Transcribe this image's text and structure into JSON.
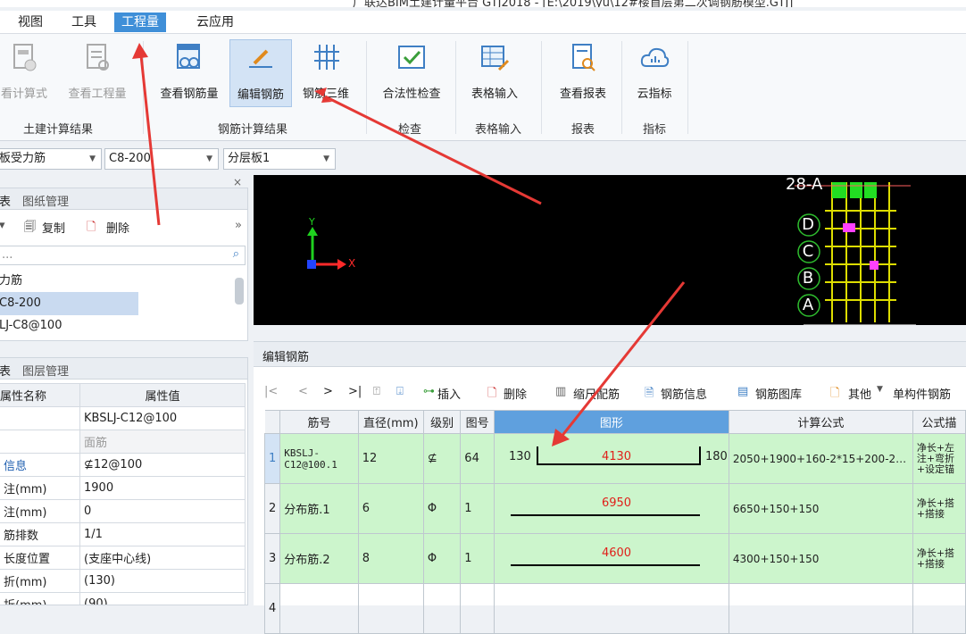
{
  "titlebar": {
    "text": "广联达BIM土建计量平台 GTJ2018 - [E:\\2019\\yu\\12#楼首层第二次调钢筋模型.GTJ]"
  },
  "menu": [
    {
      "label": "视图"
    },
    {
      "label": "工具"
    },
    {
      "label": "工程量",
      "active": true
    },
    {
      "label": "云应用"
    }
  ],
  "ribbon": {
    "buttons": [
      {
        "label": "看计算式",
        "icon": "calc-formula-icon"
      },
      {
        "label": "查看工程量",
        "icon": "view-quantity-icon"
      },
      {
        "label": "查看钢筋量",
        "icon": "view-rebar-quantity-icon"
      },
      {
        "label": "编辑钢筋",
        "icon": "edit-rebar-icon"
      },
      {
        "label": "钢筋三维",
        "icon": "rebar-3d-icon"
      },
      {
        "label": "合法性检查",
        "icon": "validity-check-icon"
      },
      {
        "label": "表格输入",
        "icon": "table-input-icon"
      },
      {
        "label": "查看报表",
        "icon": "view-report-icon"
      },
      {
        "label": "云指标",
        "icon": "cloud-index-icon"
      }
    ],
    "groups": [
      "土建计算结果",
      "钢筋计算结果",
      "检查",
      "表格输入",
      "报表",
      "指标"
    ]
  },
  "toolrow": {
    "combo1": "板受力筋",
    "combo2": "C8-200",
    "combo3": "分层板1"
  },
  "leftTop": {
    "tabs": [
      "表",
      "图纸管理"
    ],
    "actions": {
      "copy": "复制",
      "delete": "删除"
    },
    "search_placeholder": "...",
    "items": [
      "力筋",
      "C8-200",
      "LJ-C8@100"
    ]
  },
  "leftBottom": {
    "tabs": [
      "表",
      "图层管理"
    ],
    "headers": {
      "name": "属性名称",
      "value": "属性值"
    },
    "rows": [
      {
        "name": "",
        "value": "KBSLJ-C12@100"
      },
      {
        "name": "",
        "value": "面筋"
      },
      {
        "name": "信息",
        "value": "⊈12@100"
      },
      {
        "name": "注(mm)",
        "value": "1900"
      },
      {
        "name": "注(mm)",
        "value": "0"
      },
      {
        "name": "筋排数",
        "value": "1/1"
      },
      {
        "name": "长度位置",
        "value": "(支座中心线)"
      },
      {
        "name": "折(mm)",
        "value": "(130)"
      },
      {
        "name": "折(mm)",
        "value": "(90)"
      }
    ]
  },
  "viewport": {
    "axis_x": "X",
    "axis_y": "Y",
    "grid_labels": [
      "D",
      "C",
      "B",
      "A"
    ],
    "top_label": "28-A"
  },
  "rebarPanel": {
    "title": "编辑钢筋",
    "toolbar": {
      "insert": "插入",
      "delete": "删除",
      "scale": "缩尺配筋",
      "info": "钢筋信息",
      "library": "钢筋图库",
      "other": "其他",
      "single": "单构件钢筋"
    },
    "headers": [
      "筋号",
      "直径(mm)",
      "级别",
      "图号",
      "图形",
      "计算公式",
      "公式描"
    ],
    "rows": [
      {
        "idx": "1",
        "name": "KBSLJ-\nC12@100.1",
        "dia": "12",
        "grade": "⊈",
        "fig": "64",
        "left": "130",
        "mid": "4130",
        "right": "180",
        "formula": "2050+1900+160-2*15+200-2…",
        "desc": "净长+左\n注+弯折\n+设定锚"
      },
      {
        "idx": "2",
        "name": "分布筋.1",
        "dia": "6",
        "grade": "Φ",
        "fig": "1",
        "mid": "6950",
        "formula": "6650+150+150",
        "desc": "净长+搭\n+搭接"
      },
      {
        "idx": "3",
        "name": "分布筋.2",
        "dia": "8",
        "grade": "Φ",
        "fig": "1",
        "mid": "4600",
        "formula": "4300+150+150",
        "desc": "净长+搭\n+搭接"
      },
      {
        "idx": "4"
      }
    ]
  },
  "colors": {
    "accent": "#3f8fd8",
    "row_green": "#ccf5cc",
    "arrow_red": "#e53935",
    "value_red": "#e0201a"
  }
}
